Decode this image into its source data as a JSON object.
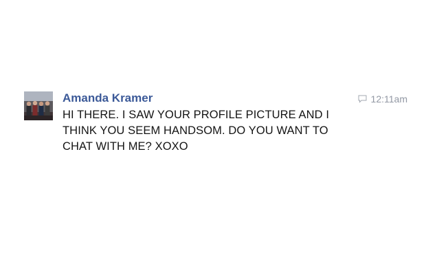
{
  "message": {
    "sender": "Amanda Kramer",
    "text": "HI THERE. I SAW YOUR PROFILE PICTURE AND I THINK YOU SEEM HANDSOM. DO YOU WANT TO CHAT WITH ME? XOXO",
    "time": "12:11am",
    "avatar_icon": "profile-photo-group",
    "meta_icon": "chat-bubble-icon"
  },
  "colors": {
    "sender_link": "#3b5998",
    "body_text": "#141414",
    "timestamp": "#9197a3"
  }
}
